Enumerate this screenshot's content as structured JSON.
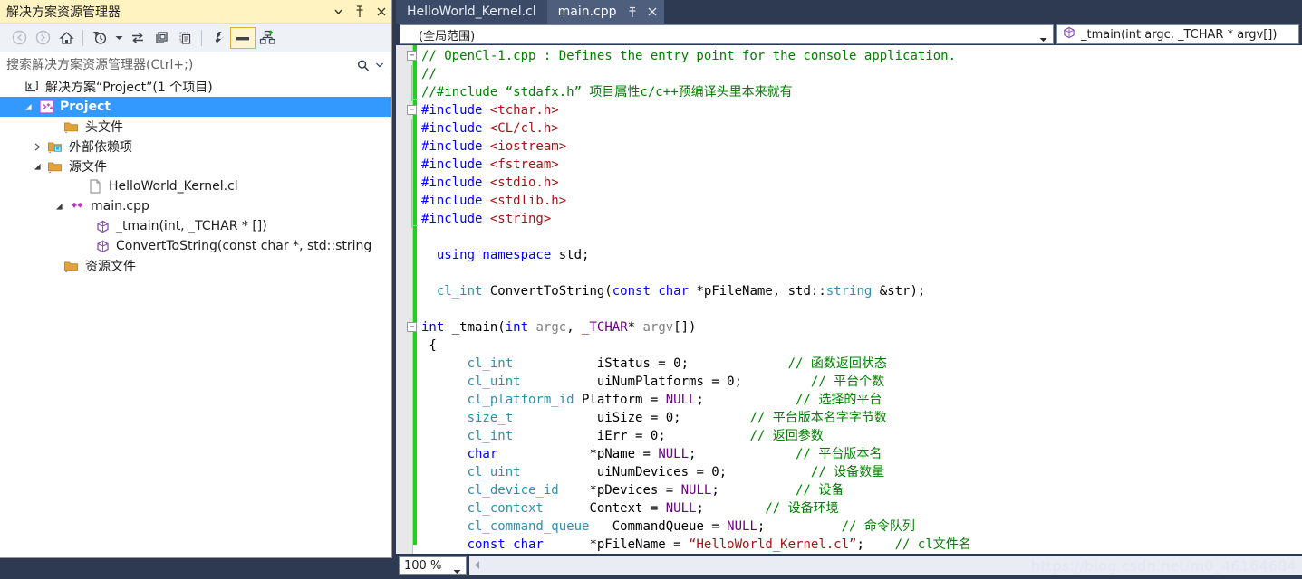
{
  "solution_explorer": {
    "title": "解决方案资源管理器",
    "title_buttons": [
      {
        "name": "dropdown-icon",
        "label": "▾"
      },
      {
        "name": "pin-icon",
        "label": "⌸"
      },
      {
        "name": "close-icon",
        "label": "✕"
      }
    ],
    "toolbar": [
      {
        "name": "back-arrow-icon",
        "label": "Back"
      },
      {
        "name": "forward-arrow-icon",
        "label": "Forward"
      },
      {
        "name": "home-icon",
        "label": "Home"
      },
      {
        "name": "pending-changes-filter-icon",
        "label": "Pending Changes Filter"
      },
      {
        "name": "dropdown-caret-icon",
        "label": "Filter options"
      },
      {
        "name": "sync-with-active-document-icon",
        "label": "Sync with Active Document"
      },
      {
        "name": "refresh-icon",
        "label": "Refresh"
      },
      {
        "name": "show-all-files-icon",
        "label": "Show All Files"
      },
      {
        "name": "properties-wrench-icon",
        "label": "Properties"
      },
      {
        "name": "preview-selected-items-icon",
        "label": "Preview Selected Items"
      },
      {
        "name": "class-view-icon",
        "label": "Class View"
      }
    ],
    "search": {
      "placeholder": "搜索解决方案资源管理器(Ctrl+;)",
      "value": "",
      "icon": "search-icon",
      "caret": "▾"
    },
    "tree": [
      {
        "depth": 0,
        "arrow": "",
        "icon": "solution-icon",
        "label": "解决方案“Project”(1 个项目)",
        "selected": false
      },
      {
        "depth": 1,
        "arrow": "expanded",
        "icon": "cpp-project-icon",
        "label": "Project",
        "selected": true
      },
      {
        "depth": 2,
        "arrow": "",
        "icon": "folder-icon",
        "label": "头文件",
        "selected": false
      },
      {
        "depth": 2,
        "arrow": "collapsed",
        "icon": "external-dependencies-icon",
        "label": "外部依赖项",
        "selected": false
      },
      {
        "depth": 2,
        "arrow": "expanded",
        "icon": "folder-icon",
        "label": "源文件",
        "selected": false
      },
      {
        "depth": 3,
        "arrow": "",
        "icon": "file-icon",
        "label": "HelloWorld_Kernel.cl",
        "selected": false
      },
      {
        "depth": 3,
        "arrow": "expanded",
        "icon": "cpp-file-icon",
        "label": "main.cpp",
        "selected": false
      },
      {
        "depth": 4,
        "arrow": "",
        "icon": "method-icon",
        "label": "_tmain(int, _TCHAR * [])",
        "selected": false
      },
      {
        "depth": 4,
        "arrow": "",
        "icon": "method-icon",
        "label": "ConvertToString(const char *, std::string",
        "selected": false
      },
      {
        "depth": 2,
        "arrow": "",
        "icon": "folder-icon",
        "label": "资源文件",
        "selected": false
      }
    ]
  },
  "editor": {
    "tabs": [
      {
        "label": "HelloWorld_Kernel.cl",
        "active": false,
        "buttons": []
      },
      {
        "label": "main.cpp",
        "active": true,
        "buttons": [
          {
            "name": "pin-icon",
            "label": "⌸"
          },
          {
            "name": "close-icon",
            "label": "✕"
          }
        ]
      }
    ],
    "scope_left": {
      "value": "(全局范围)",
      "caret": "▾"
    },
    "scope_right": {
      "value": "_tmain(int argc, _TCHAR * argv[])",
      "icon": "method-icon",
      "caret": "▾"
    },
    "zoom": {
      "value": "100 %",
      "caret": "▾"
    },
    "watermark": "https://blog.csdn.net/m0_46164684",
    "code_lines": [
      {
        "fold": "minus",
        "bar": "start",
        "tokens": [
          {
            "t": "c",
            "v": "// OpenCl-1.cpp : Defines the entry point for the console application."
          }
        ]
      },
      {
        "fold": "",
        "bar": "mid",
        "tokens": [
          {
            "t": "c",
            "v": "//"
          }
        ]
      },
      {
        "fold": "",
        "bar": "end",
        "tokens": [
          {
            "t": "c",
            "v": "//#include “stdafx.h” 项目属性c/c++预编译头里本来就有"
          }
        ]
      },
      {
        "fold": "minus",
        "bar": "start",
        "tokens": [
          {
            "t": "k",
            "v": "#include "
          },
          {
            "t": "s",
            "v": "<tchar.h>"
          }
        ]
      },
      {
        "fold": "",
        "bar": "mid",
        "tokens": [
          {
            "t": "k",
            "v": "#include "
          },
          {
            "t": "s",
            "v": "<CL/cl.h>"
          }
        ]
      },
      {
        "fold": "",
        "bar": "mid",
        "tokens": [
          {
            "t": "k",
            "v": "#include "
          },
          {
            "t": "s",
            "v": "<iostream>"
          }
        ]
      },
      {
        "fold": "",
        "bar": "mid",
        "tokens": [
          {
            "t": "k",
            "v": "#include "
          },
          {
            "t": "s",
            "v": "<fstream>"
          }
        ]
      },
      {
        "fold": "",
        "bar": "mid",
        "tokens": [
          {
            "t": "k",
            "v": "#include "
          },
          {
            "t": "s",
            "v": "<stdio.h>"
          }
        ]
      },
      {
        "fold": "",
        "bar": "mid",
        "tokens": [
          {
            "t": "k",
            "v": "#include "
          },
          {
            "t": "s",
            "v": "<stdlib.h>"
          }
        ]
      },
      {
        "fold": "",
        "bar": "end",
        "tokens": [
          {
            "t": "k",
            "v": "#include "
          },
          {
            "t": "s",
            "v": "<string>"
          }
        ]
      },
      {
        "fold": "",
        "bar": "",
        "tokens": []
      },
      {
        "fold": "",
        "bar": "",
        "tokens": [
          {
            "t": "n",
            "v": "  "
          },
          {
            "t": "k",
            "v": "using namespace"
          },
          {
            "t": "n",
            "v": " std;"
          }
        ]
      },
      {
        "fold": "",
        "bar": "",
        "tokens": []
      },
      {
        "fold": "",
        "bar": "",
        "tokens": [
          {
            "t": "n",
            "v": "  "
          },
          {
            "t": "t",
            "v": "cl_int"
          },
          {
            "t": "n",
            "v": " ConvertToString("
          },
          {
            "t": "k",
            "v": "const"
          },
          {
            "t": "n",
            "v": " "
          },
          {
            "t": "k",
            "v": "char"
          },
          {
            "t": "n",
            "v": " *pFileName, std::"
          },
          {
            "t": "t",
            "v": "string"
          },
          {
            "t": "n",
            "v": " &str);"
          }
        ]
      },
      {
        "fold": "",
        "bar": "",
        "tokens": []
      },
      {
        "fold": "minus",
        "bar": "",
        "tokens": [
          {
            "t": "k",
            "v": "int"
          },
          {
            "t": "n",
            "v": " _tmain("
          },
          {
            "t": "k",
            "v": "int"
          },
          {
            "t": "n",
            "v": " "
          },
          {
            "t": "p",
            "v": "argc"
          },
          {
            "t": "n",
            "v": ", "
          },
          {
            "t": "m",
            "v": "_TCHAR"
          },
          {
            "t": "n",
            "v": "* "
          },
          {
            "t": "p",
            "v": "argv"
          },
          {
            "t": "n",
            "v": "[])"
          }
        ]
      },
      {
        "fold": "",
        "bar": "",
        "tokens": [
          {
            "t": "n",
            "v": " {"
          }
        ]
      },
      {
        "fold": "",
        "bar": "",
        "tokens": [
          {
            "t": "n",
            "v": "      "
          },
          {
            "t": "t",
            "v": "cl_int"
          },
          {
            "t": "n",
            "v": "           iStatus = 0;             "
          },
          {
            "t": "c",
            "v": "// 函数返回状态"
          }
        ]
      },
      {
        "fold": "",
        "bar": "",
        "tokens": [
          {
            "t": "n",
            "v": "      "
          },
          {
            "t": "t",
            "v": "cl_uint"
          },
          {
            "t": "n",
            "v": "          uiNumPlatforms = 0;         "
          },
          {
            "t": "c",
            "v": "// 平台个数"
          }
        ]
      },
      {
        "fold": "",
        "bar": "",
        "tokens": [
          {
            "t": "n",
            "v": "      "
          },
          {
            "t": "t",
            "v": "cl_platform_id"
          },
          {
            "t": "n",
            "v": " Platform = "
          },
          {
            "t": "m",
            "v": "NULL"
          },
          {
            "t": "n",
            "v": ";            "
          },
          {
            "t": "c",
            "v": "// 选择的平台"
          }
        ]
      },
      {
        "fold": "",
        "bar": "",
        "tokens": [
          {
            "t": "n",
            "v": "      "
          },
          {
            "t": "t",
            "v": "size_t"
          },
          {
            "t": "n",
            "v": "           uiSize = 0;         "
          },
          {
            "t": "c",
            "v": "// 平台版本名字字节数"
          }
        ]
      },
      {
        "fold": "",
        "bar": "",
        "tokens": [
          {
            "t": "n",
            "v": "      "
          },
          {
            "t": "t",
            "v": "cl_int"
          },
          {
            "t": "n",
            "v": "           iErr = 0;           "
          },
          {
            "t": "c",
            "v": "// 返回参数"
          }
        ]
      },
      {
        "fold": "",
        "bar": "",
        "tokens": [
          {
            "t": "n",
            "v": "      "
          },
          {
            "t": "k",
            "v": "char"
          },
          {
            "t": "n",
            "v": "            *pName = "
          },
          {
            "t": "m",
            "v": "NULL"
          },
          {
            "t": "n",
            "v": ";             "
          },
          {
            "t": "c",
            "v": "// 平台版本名"
          }
        ]
      },
      {
        "fold": "",
        "bar": "",
        "tokens": [
          {
            "t": "n",
            "v": "      "
          },
          {
            "t": "t",
            "v": "cl_uint"
          },
          {
            "t": "n",
            "v": "          uiNumDevices = 0;           "
          },
          {
            "t": "c",
            "v": "// 设备数量"
          }
        ]
      },
      {
        "fold": "",
        "bar": "",
        "tokens": [
          {
            "t": "n",
            "v": "      "
          },
          {
            "t": "t",
            "v": "cl_device_id"
          },
          {
            "t": "n",
            "v": "    *pDevices = "
          },
          {
            "t": "m",
            "v": "NULL"
          },
          {
            "t": "n",
            "v": ";          "
          },
          {
            "t": "c",
            "v": "// 设备"
          }
        ]
      },
      {
        "fold": "",
        "bar": "",
        "tokens": [
          {
            "t": "n",
            "v": "      "
          },
          {
            "t": "t",
            "v": "cl_context"
          },
          {
            "t": "n",
            "v": "      Context = "
          },
          {
            "t": "m",
            "v": "NULL"
          },
          {
            "t": "n",
            "v": ";        "
          },
          {
            "t": "c",
            "v": "// 设备环境"
          }
        ]
      },
      {
        "fold": "",
        "bar": "",
        "tokens": [
          {
            "t": "n",
            "v": "      "
          },
          {
            "t": "t",
            "v": "cl_command_queue"
          },
          {
            "t": "n",
            "v": "   CommandQueue = "
          },
          {
            "t": "m",
            "v": "NULL"
          },
          {
            "t": "n",
            "v": ";          "
          },
          {
            "t": "c",
            "v": "// 命令队列"
          }
        ]
      },
      {
        "fold": "",
        "bar": "",
        "tokens": [
          {
            "t": "n",
            "v": "      "
          },
          {
            "t": "k",
            "v": "const char"
          },
          {
            "t": "n",
            "v": "      *pFileName = "
          },
          {
            "t": "s",
            "v": "“HelloWorld_Kernel.cl”"
          },
          {
            "t": "n",
            "v": ";    "
          },
          {
            "t": "c",
            "v": "// cl文件名"
          }
        ]
      }
    ]
  },
  "colors": {
    "title_bar": "#fff3c2",
    "selection": "#3399ff",
    "chrome": "#2d3a52",
    "tab_active": "#4e5f7d",
    "tab_inactive": "#3b4a66",
    "change_bar": "#1fd11f",
    "keyword": "#0000ff",
    "type": "#2b91af",
    "string": "#a31515",
    "comment": "#008000",
    "macro": "#6f008a"
  }
}
